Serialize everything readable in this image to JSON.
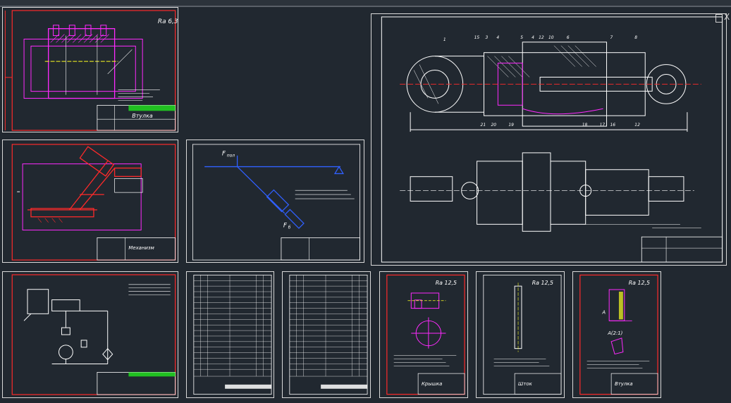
{
  "window": {
    "close_label": "X"
  },
  "sheets": {
    "bushing_top": {
      "roughness": "Ra 6,3",
      "title": "Втулка"
    },
    "mechanism": {
      "title": "Механизм"
    },
    "force_scheme": {
      "force_top": "F",
      "force_top_sub": "пол",
      "force_bottom": "F",
      "force_bottom_sub": "б"
    },
    "cover": {
      "roughness": "Ra 12,5",
      "title": "Крышка"
    },
    "rod": {
      "roughness": "Ra 12,5",
      "title": "Шток"
    },
    "bushing_bottom": {
      "roughness": "Ra 12,5",
      "title": "Втулка",
      "section": "А(2:1)",
      "view_letter": "А"
    },
    "cylinder": {
      "leaders": [
        "1",
        "15",
        "3",
        "4",
        "5",
        "4",
        "12",
        "10",
        "8",
        "7",
        "6",
        "21",
        "20",
        "19",
        "18",
        "17",
        "16",
        "12"
      ]
    }
  },
  "colors": {
    "background": "#212830",
    "sheet_frame": "#d9d9d9",
    "drawing_frame_red": "#ff2a2a",
    "contour_magenta": "#ff2aff",
    "contour_white": "#ffffff",
    "scheme_blue": "#3060ff",
    "center_yellow": "#ffff20",
    "title_block_green": "#21c021"
  }
}
